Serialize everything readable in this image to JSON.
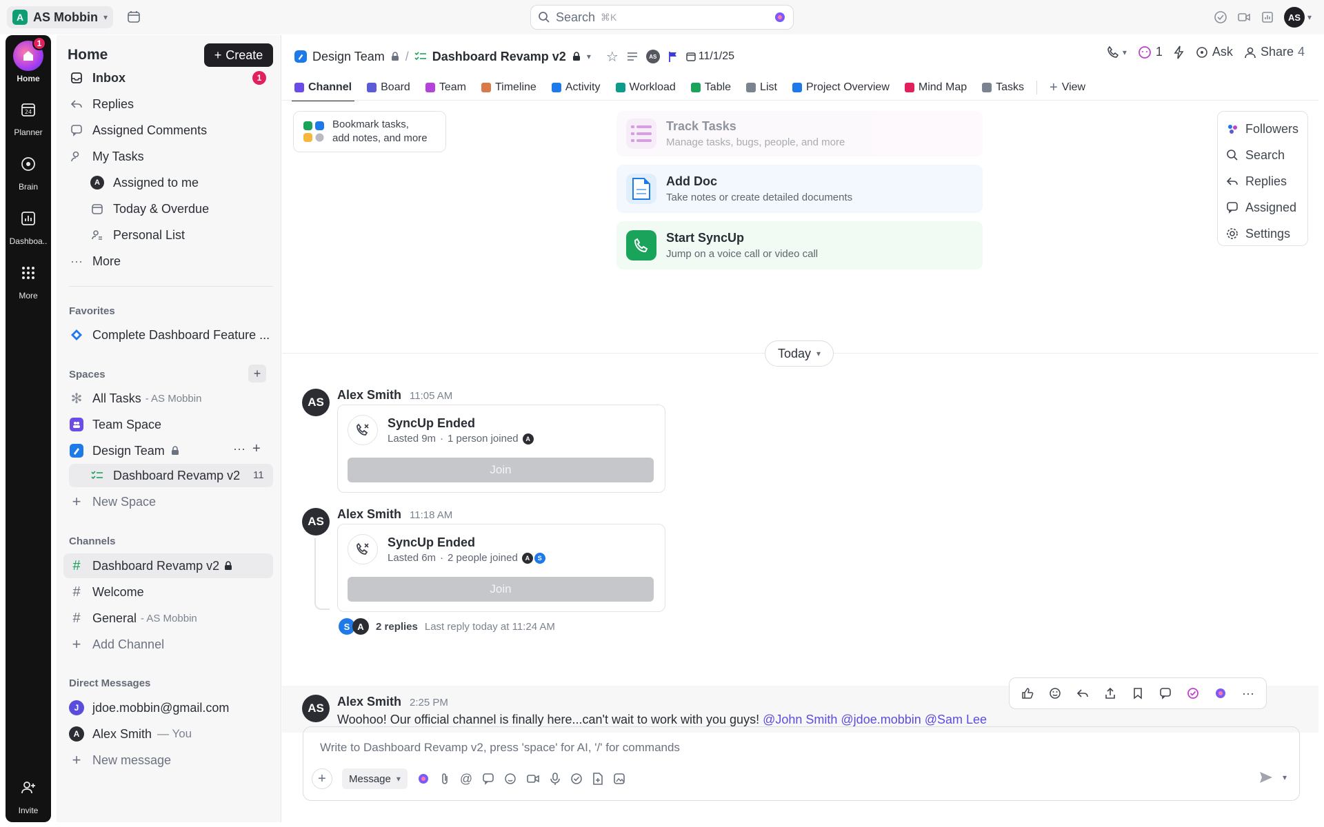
{
  "topbar": {
    "workspace_initial": "A",
    "workspace_name": "AS Mobbin",
    "search_placeholder": "Search",
    "search_shortcut": "⌘K",
    "user_initials": "AS"
  },
  "rail": {
    "items": [
      {
        "label": "Home",
        "badge": "1"
      },
      {
        "label": "Planner"
      },
      {
        "label": "Brain"
      },
      {
        "label": "Dashboa.."
      },
      {
        "label": "More"
      },
      {
        "label": "Invite"
      }
    ]
  },
  "sidebar": {
    "title": "Home",
    "create_label": "Create",
    "nav": [
      {
        "label": "Inbox",
        "badge": "1"
      },
      {
        "label": "Replies"
      },
      {
        "label": "Assigned Comments"
      },
      {
        "label": "My Tasks"
      },
      {
        "label": "Assigned to me"
      },
      {
        "label": "Today & Overdue"
      },
      {
        "label": "Personal List"
      },
      {
        "label": "More"
      }
    ],
    "favorites_title": "Favorites",
    "favorites": [
      {
        "label": "Complete Dashboard Feature ..."
      }
    ],
    "spaces_title": "Spaces",
    "spaces": [
      {
        "label": "All Tasks",
        "sub": "- AS Mobbin"
      },
      {
        "label": "Team Space"
      },
      {
        "label": "Design Team"
      },
      {
        "label": "Dashboard Revamp v2",
        "count": "11"
      },
      {
        "label": "New Space"
      }
    ],
    "channels_title": "Channels",
    "channels": [
      {
        "label": "Dashboard Revamp v2"
      },
      {
        "label": "Welcome"
      },
      {
        "label": "General",
        "sub": "- AS Mobbin"
      },
      {
        "label": "Add Channel"
      }
    ],
    "dm_title": "Direct Messages",
    "dms": [
      {
        "label": "jdoe.mobbin@gmail.com",
        "initial": "J"
      },
      {
        "label": "Alex Smith",
        "sub": "— You",
        "initial": "A"
      },
      {
        "label": "New message"
      }
    ]
  },
  "header": {
    "crumb_space": "Design Team",
    "crumb_list": "Dashboard Revamp v2",
    "assignee_initials": "AS",
    "date": "11/1/25",
    "notif_count": "1",
    "ask_label": "Ask",
    "share_label": "Share",
    "share_count": "4"
  },
  "tabs": [
    {
      "label": "Channel",
      "color": "#6b4ce6"
    },
    {
      "label": "Board",
      "color": "#5b5bd6"
    },
    {
      "label": "Team",
      "color": "#b444d8"
    },
    {
      "label": "Timeline",
      "color": "#d87a4a"
    },
    {
      "label": "Activity",
      "color": "#1e7ae8"
    },
    {
      "label": "Workload",
      "color": "#0d9c8c"
    },
    {
      "label": "Table",
      "color": "#1aa35a"
    },
    {
      "label": "List",
      "color": "#7b8390"
    },
    {
      "label": "Project Overview",
      "color": "#1e7ae8"
    },
    {
      "label": "Mind Map",
      "color": "#e0215d"
    },
    {
      "label": "Tasks",
      "color": "#7b8390"
    },
    {
      "label": "View",
      "color": "#656f7d"
    }
  ],
  "bookmark": {
    "line1": "Bookmark tasks,",
    "line2": "add notes, and more"
  },
  "cards": [
    {
      "title": "Track Tasks",
      "desc": "Manage tasks, bugs, people, and more",
      "bg": "#fcf7fc"
    },
    {
      "title": "Add Doc",
      "desc": "Take notes or create detailed documents",
      "bg": "#f3f8fe"
    },
    {
      "title": "Start SyncUp",
      "desc": "Jump on a voice call or video call",
      "bg": "#f1fbf4"
    }
  ],
  "side_panel": [
    {
      "label": "Followers"
    },
    {
      "label": "Search"
    },
    {
      "label": "Replies"
    },
    {
      "label": "Assigned"
    },
    {
      "label": "Settings"
    }
  ],
  "today_label": "Today",
  "messages": [
    {
      "avatar": "AS",
      "author": "Alex Smith",
      "time": "11:05 AM",
      "title": "SyncUp Ended",
      "lasted": "Lasted 9m",
      "joined": "1 person joined",
      "join_label": "Join"
    },
    {
      "avatar": "AS",
      "author": "Alex Smith",
      "time": "11:18 AM",
      "title": "SyncUp Ended",
      "lasted": "Lasted 6m",
      "joined": "2 people joined",
      "join_label": "Join"
    },
    {
      "avatar": "AS",
      "author": "Alex Smith",
      "time": "2:25 PM",
      "text": "Woohoo! Our official channel is finally here...can't wait to work with you guys!",
      "mentions": [
        "@John Smith",
        "@jdoe.mobbin",
        "@Sam Lee"
      ]
    }
  ],
  "thread": {
    "replies": "2 replies",
    "last_reply": "Last reply today at 11:24 AM",
    "av1": "S",
    "av2": "A"
  },
  "composer": {
    "placeholder": "Write to Dashboard Revamp v2, press 'space' for AI, '/' for commands",
    "message_type": "Message"
  },
  "mini_avatars": {
    "a": "A",
    "s": "S"
  }
}
